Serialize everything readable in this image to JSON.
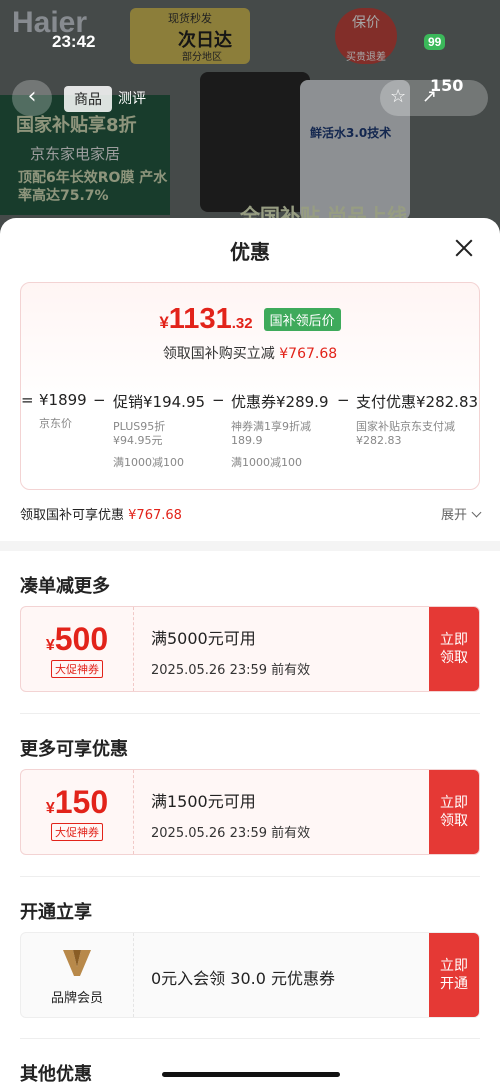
{
  "background": {
    "brand": "Haier",
    "status_time": "23:42",
    "battery": "99",
    "next_day_top": "现货秒发",
    "next_day_main": "次日达",
    "next_day_sub": "部分地区",
    "badge_top": "保价",
    "badge_bottom": "买贵退差",
    "promo_line1": "国家补贴享8折",
    "promo_line2": "京东家电家居",
    "promo_line3": "顶配6年长效RO膜 产水率高达75.7%",
    "product_text": "鲜活水3.0技术",
    "nav_tab_active": "商品",
    "nav_tab_other": "测评",
    "coupon_amount": "150",
    "bottom_banner": "全国补贴 尚品上线"
  },
  "sheet": {
    "title": "优惠",
    "final_price": {
      "currency": "¥",
      "integer": "1131",
      "decimal": ".32"
    },
    "final_tag": "国补领后价",
    "final_sub_label": "领取国补购买立减",
    "final_sub_amount": "¥767.68",
    "breakdown": [
      {
        "op": "=",
        "main": "¥1899",
        "s1": "京东价",
        "s2": "",
        "s3": ""
      },
      {
        "op": "−",
        "main": "促销¥194.95",
        "s1": "PLUS95折",
        "s2": "¥94.95元",
        "s3": "满1000减100"
      },
      {
        "op": "−",
        "main": "优惠券¥289.9",
        "s1": "神券满1享9折减",
        "s2": "189.9",
        "s3": "满1000减100"
      },
      {
        "op": "−",
        "main": "支付优惠¥282.83",
        "s1": "国家补贴京东支付减",
        "s2": "¥282.83",
        "s3": ""
      }
    ],
    "summary_label": "领取国补可享优惠",
    "summary_amount": "¥767.68",
    "expand_label": "展开"
  },
  "sections": [
    {
      "title": "凑单减更多",
      "coupon": {
        "currency": "¥",
        "amount": "500",
        "tag": "大促神券",
        "condition": "满5000元可用",
        "expiry": "2025.05.26 23:59 前有效",
        "button_line1": "立即",
        "button_line2": "领取"
      }
    },
    {
      "title": "更多可享优惠",
      "coupon": {
        "currency": "¥",
        "amount": "150",
        "tag": "大促神券",
        "condition": "满1500元可用",
        "expiry": "2025.05.26 23:59 前有效",
        "button_line1": "立即",
        "button_line2": "领取"
      }
    }
  ],
  "membership": {
    "title": "开通立享",
    "label": "品牌会员",
    "offer": "0元入会领 30.0 元优惠券",
    "button_line1": "立即",
    "button_line2": "开通"
  },
  "other_title": "其他优惠",
  "colors": {
    "accent_red": "#e2231a",
    "button_red": "#e53935",
    "tag_green": "#3eaa5b"
  }
}
